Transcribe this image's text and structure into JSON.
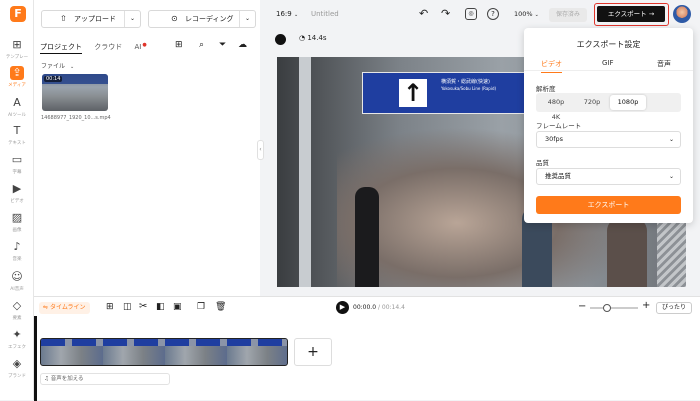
{
  "rail": {
    "items": [
      {
        "icon": "template-icon",
        "glyph": "⊞",
        "label": "テンプレー"
      },
      {
        "icon": "media-icon",
        "glyph": "⇪",
        "label": "メディア"
      },
      {
        "icon": "ai-tools-icon",
        "glyph": "A",
        "label": "AIツール"
      },
      {
        "icon": "text-icon",
        "glyph": "T",
        "label": "テキスト"
      },
      {
        "icon": "subtitles-icon",
        "glyph": "▭",
        "label": "字幕"
      },
      {
        "icon": "video-icon",
        "glyph": "▶",
        "label": "ビデオ"
      },
      {
        "icon": "image-icon",
        "glyph": "▨",
        "label": "画像"
      },
      {
        "icon": "music-icon",
        "glyph": "♪",
        "label": "音楽"
      },
      {
        "icon": "ai-voice-icon",
        "glyph": "☺",
        "label": "AI音声"
      },
      {
        "icon": "elements-icon",
        "glyph": "◇",
        "label": "要素"
      },
      {
        "icon": "effects-icon",
        "glyph": "✦",
        "label": "エフェク"
      },
      {
        "icon": "brand-icon",
        "glyph": "◈",
        "label": "ブランド"
      }
    ]
  },
  "media": {
    "upload_label": "アップロード",
    "record_label": "レコーディング",
    "tabs": [
      "プロジェクト",
      "クラウド",
      "AI"
    ],
    "folder_label": "ファイル",
    "thumb_duration": "00:14",
    "thumb_name": "14688977_1920_10...s.mp4"
  },
  "topbar": {
    "ratio": "16:9",
    "title": "Untitled",
    "zoom": "100%",
    "saved": "保存済み",
    "export_label": "エクスポート"
  },
  "preview": {
    "duration": "14.4s",
    "sign_arrow": "↑",
    "sign_line1": "横須賀・総武線(快速)",
    "sign_line2": "Yokosuka/Sobu Line (Rapid)"
  },
  "timeline": {
    "label": "タイムライン",
    "time_current": "00:00.0",
    "time_total": "00:14.4",
    "fit_label": "ぴったり",
    "audio_label": "音声を加える"
  },
  "export": {
    "title": "エクスポート設定",
    "tabs": [
      "ビデオ",
      "GIF",
      "音声"
    ],
    "resolution_label": "解析度",
    "resolutions": [
      "480p",
      "720p",
      "1080p",
      "4K"
    ],
    "selected_resolution": "1080p",
    "framerate_label": "フレームレート",
    "framerate_value": "30fps",
    "quality_label": "品質",
    "quality_value": "推奨品質",
    "export_button": "エクスポート"
  },
  "colors": {
    "accent": "#ff7a1a",
    "export_dark": "#111111",
    "highlight": "#e0352b"
  }
}
